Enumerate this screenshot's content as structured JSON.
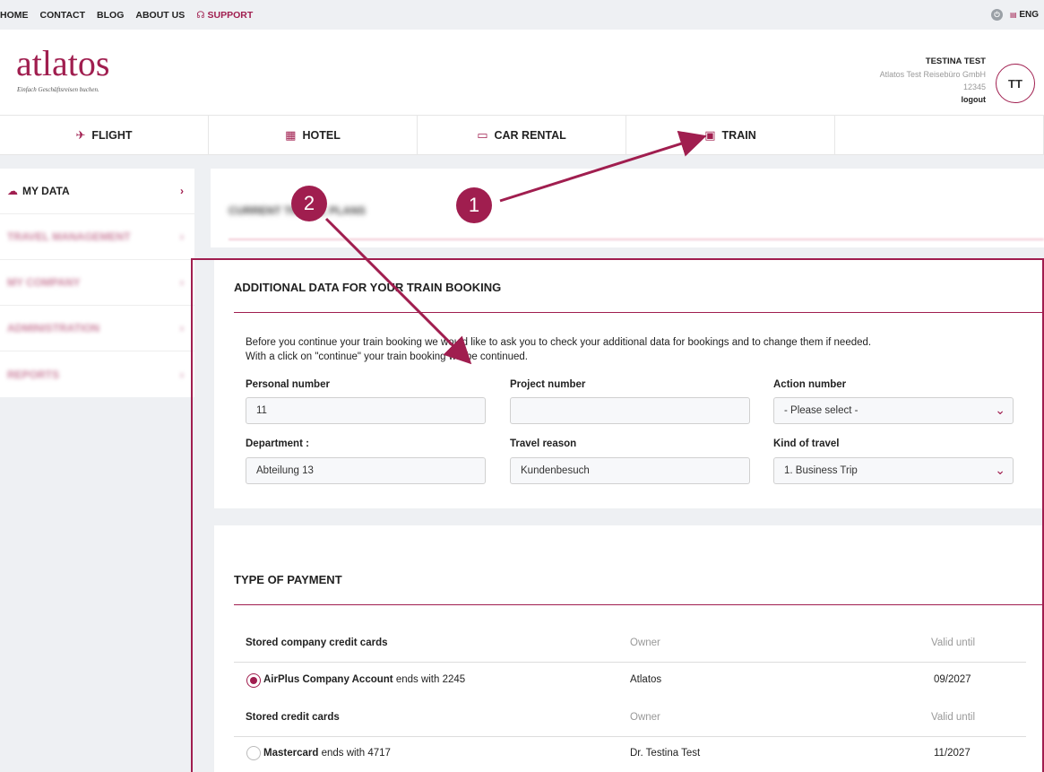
{
  "topbar": {
    "links": [
      "HOME",
      "CONTACT",
      "BLOG",
      "ABOUT US"
    ],
    "support": "SUPPORT",
    "language": "ENG"
  },
  "header": {
    "logo": "atlatos",
    "logo_sub": "Einfach Geschäftsreisen buchen.",
    "user_name": "TESTINA TEST",
    "company": "Atlatos Test Reisebüro GmbH",
    "number": "12345",
    "logout": "logout",
    "avatar": "TT"
  },
  "tabs": [
    {
      "label": "FLIGHT",
      "icon": "plane-icon"
    },
    {
      "label": "HOTEL",
      "icon": "building-icon"
    },
    {
      "label": "CAR RENTAL",
      "icon": "car-icon"
    },
    {
      "label": "TRAIN",
      "icon": "train-icon"
    }
  ],
  "sidebar": {
    "active": "MY DATA",
    "blurred": [
      "TRAVEL MANAGEMENT",
      "MY COMPANY",
      "ADMINISTRATION",
      "REPORTS"
    ]
  },
  "top_card": {
    "blurred_title": "CURRENT TRAVEL PLANS"
  },
  "booking": {
    "title": "ADDITIONAL DATA FOR YOUR TRAIN BOOKING",
    "desc1": "Before you continue your train booking we would like to ask you to check your additional data for bookings and to change them if needed.",
    "desc2": "With a click on \"continue\" your train booking will be continued.",
    "fields": {
      "personal_label": "Personal number",
      "personal_value": "11",
      "project_label": "Project number",
      "project_value": "",
      "action_label": "Action number",
      "action_value": "- Please select -",
      "department_label": "Department :",
      "department_value": "Abteilung 13",
      "reason_label": "Travel reason",
      "reason_value": "Kundenbesuch",
      "kind_label": "Kind of travel",
      "kind_value": "1. Business Trip"
    }
  },
  "payment": {
    "title": "TYPE OF PAYMENT",
    "company_header": "Stored company credit cards",
    "owner_header": "Owner",
    "valid_header": "Valid until",
    "company_card": {
      "name": "AirPlus Company Account",
      "suffix": " ends with 2245",
      "owner": "Atlatos",
      "valid": "09/2027",
      "selected": true
    },
    "cards_header": "Stored credit cards",
    "card": {
      "name": "Mastercard",
      "suffix": " ends with 4717",
      "owner": "Dr. Testina Test",
      "valid": "11/2027",
      "selected": false
    }
  },
  "annotations": {
    "badge1": "1",
    "badge2": "2"
  },
  "colors": {
    "accent": "#a01e4f",
    "background": "#eef0f3"
  }
}
